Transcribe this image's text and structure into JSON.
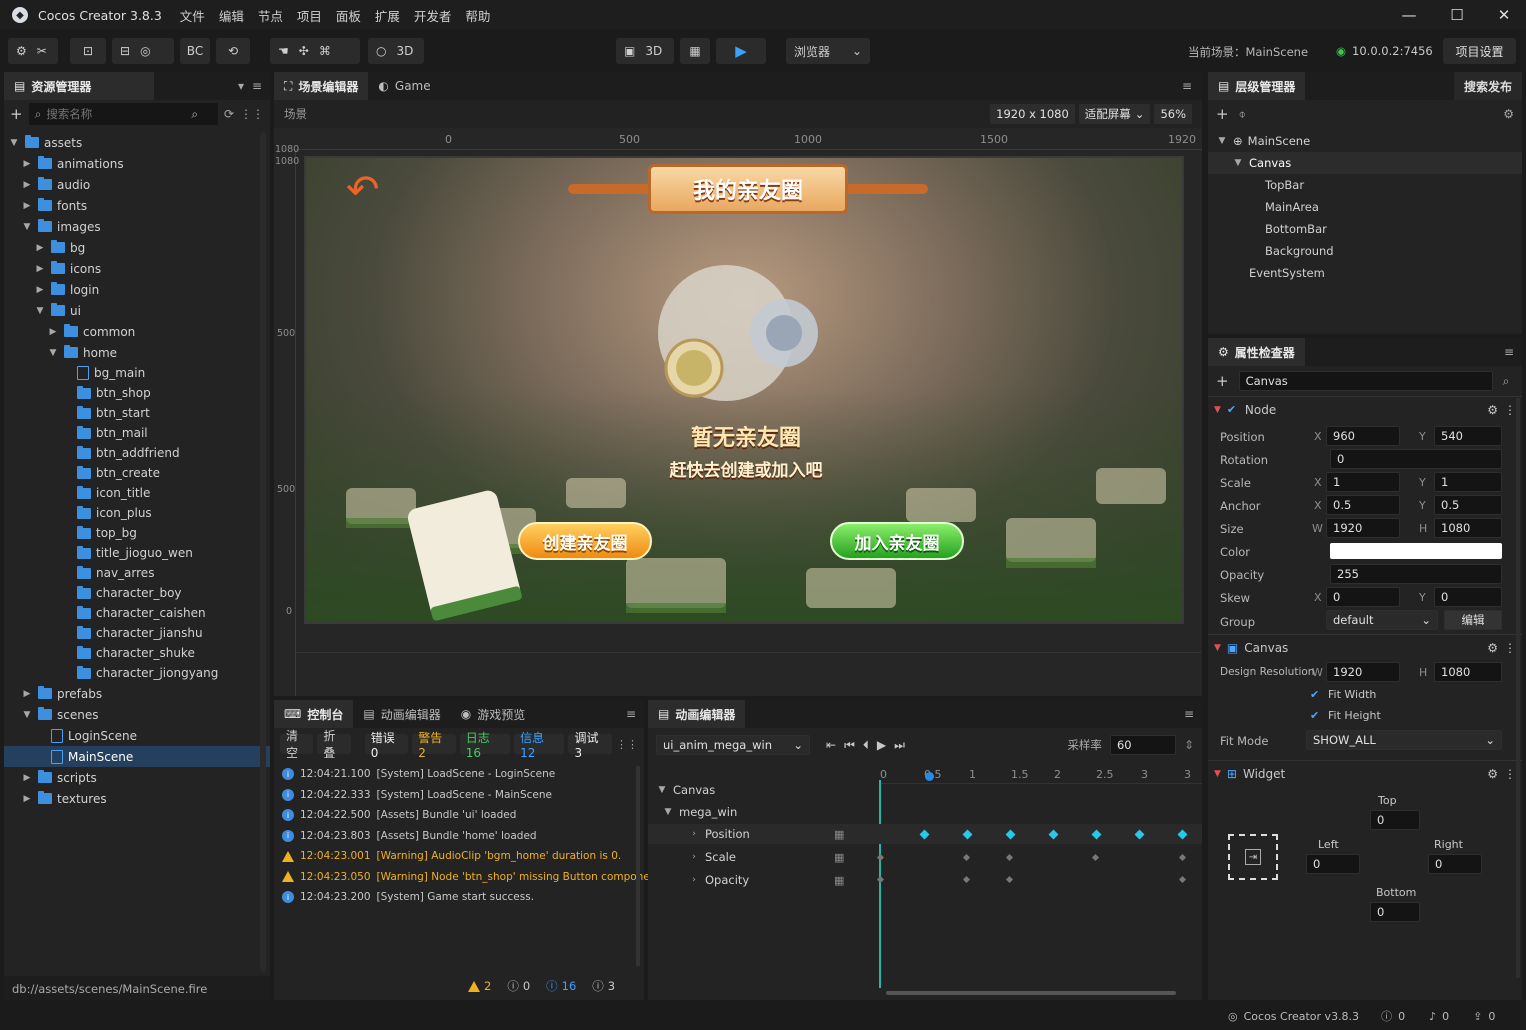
{
  "app": {
    "title": "Cocos Creator 3.8.3"
  },
  "menu": [
    "文件",
    "编辑",
    "节点",
    "项目",
    "面板",
    "扩展",
    "开发者",
    "帮助"
  ],
  "toolbar": {
    "bc": "BC",
    "mode3d": "3D",
    "view3d": "3D",
    "preview_target": "浏览器",
    "current_scene_label": "当前场景：",
    "current_scene": "MainScene",
    "ip": "10.0.0.2:7456",
    "project_settings": "项目设置"
  },
  "assets": {
    "tab": "资源管理器",
    "search_placeholder": "搜索名称",
    "tree": [
      {
        "label": "assets",
        "depth": 0,
        "type": "folder",
        "open": true
      },
      {
        "label": "animations",
        "depth": 1,
        "type": "folder"
      },
      {
        "label": "audio",
        "depth": 1,
        "type": "folder"
      },
      {
        "label": "fonts",
        "depth": 1,
        "type": "folder"
      },
      {
        "label": "images",
        "depth": 1,
        "type": "folder",
        "open": true
      },
      {
        "label": "bg",
        "depth": 2,
        "type": "folder"
      },
      {
        "label": "icons",
        "depth": 2,
        "type": "folder"
      },
      {
        "label": "login",
        "depth": 2,
        "type": "folder"
      },
      {
        "label": "ui",
        "depth": 2,
        "type": "folder",
        "open": true
      },
      {
        "label": "common",
        "depth": 3,
        "type": "folder"
      },
      {
        "label": "home",
        "depth": 3,
        "type": "folder",
        "open": true
      },
      {
        "label": "bg_main",
        "depth": 4,
        "type": "file"
      },
      {
        "label": "btn_shop",
        "depth": 4,
        "type": "leaf-folder"
      },
      {
        "label": "btn_start",
        "depth": 4,
        "type": "leaf-folder"
      },
      {
        "label": "btn_mail",
        "depth": 4,
        "type": "leaf-folder"
      },
      {
        "label": "btn_addfriend",
        "depth": 4,
        "type": "leaf-folder"
      },
      {
        "label": "btn_create",
        "depth": 4,
        "type": "leaf-folder"
      },
      {
        "label": "icon_title",
        "depth": 4,
        "type": "leaf-folder"
      },
      {
        "label": "icon_plus",
        "depth": 4,
        "type": "leaf-folder"
      },
      {
        "label": "top_bg",
        "depth": 4,
        "type": "leaf-folder"
      },
      {
        "label": "title_jioguo_wen",
        "depth": 4,
        "type": "leaf-folder"
      },
      {
        "label": "nav_arres",
        "depth": 4,
        "type": "leaf-folder"
      },
      {
        "label": "character_boy",
        "depth": 4,
        "type": "leaf-folder"
      },
      {
        "label": "character_caishen",
        "depth": 4,
        "type": "leaf-folder"
      },
      {
        "label": "character_jianshu",
        "depth": 4,
        "type": "leaf-folder"
      },
      {
        "label": "character_shuke",
        "depth": 4,
        "type": "leaf-folder"
      },
      {
        "label": "character_jiongyang",
        "depth": 4,
        "type": "leaf-folder"
      },
      {
        "label": "prefabs",
        "depth": 1,
        "type": "folder"
      },
      {
        "label": "scenes",
        "depth": 1,
        "type": "folder",
        "open": true
      },
      {
        "label": "LoginScene",
        "depth": 2,
        "type": "file"
      },
      {
        "label": "MainScene",
        "depth": 2,
        "type": "file",
        "selected": true
      },
      {
        "label": "scripts",
        "depth": 1,
        "type": "folder"
      },
      {
        "label": "textures",
        "depth": 1,
        "type": "folder"
      }
    ],
    "footer_path": "db://assets/scenes/MainScene.fire"
  },
  "scene": {
    "tabs": [
      "场景编辑器",
      "Game"
    ],
    "breadcrumb": "场景",
    "resolution": "1920 x 1080",
    "fit": "适配屏幕",
    "zoom": "56%",
    "ruler_top": [
      "0",
      "500",
      "1000",
      "1500",
      "1920"
    ],
    "ruler_left": [
      "1080",
      "1080",
      "500",
      "500",
      "0"
    ],
    "game": {
      "title": "我的亲友圈",
      "empty_title": "暂无亲友圈",
      "empty_sub": "赶快去创建或加入吧",
      "btn_create": "创建亲友圈",
      "btn_join": "加入亲友圈"
    }
  },
  "console": {
    "tabs": [
      "控制台",
      "动画编辑器",
      "游戏预览"
    ],
    "buttons": {
      "clear": "清空",
      "fold": "折叠"
    },
    "filters": {
      "error": "错误 0",
      "warn": "警告 2",
      "log": "日志 16",
      "info": "信息 12",
      "debug": "调试 3"
    },
    "logs": [
      {
        "level": "info",
        "time": "12:04:21.100",
        "text": "[System] LoadScene - LoginScene"
      },
      {
        "level": "info",
        "time": "12:04:22.333",
        "text": "[System] LoadScene - MainScene"
      },
      {
        "level": "info",
        "time": "12:04:22.500",
        "text": "[Assets] Bundle 'ui' loaded"
      },
      {
        "level": "info",
        "time": "12:04:23.803",
        "text": "[Assets] Bundle 'home' loaded"
      },
      {
        "level": "warn",
        "time": "12:04:23.001",
        "text": "[Warning] AudioClip 'bgm_home' duration is 0."
      },
      {
        "level": "warn",
        "time": "12:04:23.050",
        "text": "[Warning] Node 'btn_shop' missing Button component"
      },
      {
        "level": "info",
        "time": "12:04:23.200",
        "text": "[System] Game start success."
      }
    ],
    "footer": {
      "warn": "2",
      "error": "0",
      "info": "16",
      "debug": "3"
    }
  },
  "animation": {
    "tab": "动画编辑器",
    "clip": "ui_anim_mega_win",
    "sample_label": "采样率",
    "sample": "60",
    "ticks": [
      "0",
      "0.5",
      "1",
      "1.5",
      "2",
      "2.5",
      "3",
      "3"
    ],
    "tracks": [
      {
        "label": "Canvas",
        "depth": 0
      },
      {
        "label": "mega_win",
        "depth": 1
      },
      {
        "label": "Position",
        "depth": 2
      },
      {
        "label": "Scale",
        "depth": 2
      },
      {
        "label": "Opacity",
        "depth": 2
      }
    ]
  },
  "hierarchy": {
    "tab": "层级管理器",
    "search_tab": "搜索发布",
    "tree": [
      {
        "label": "MainScene",
        "depth": 0
      },
      {
        "label": "Canvas",
        "depth": 1,
        "selected": true
      },
      {
        "label": "TopBar",
        "depth": 2
      },
      {
        "label": "MainArea",
        "depth": 2
      },
      {
        "label": "BottomBar",
        "depth": 2
      },
      {
        "label": "Background",
        "depth": 2
      },
      {
        "label": "EventSystem",
        "depth": 1
      }
    ]
  },
  "inspector": {
    "tab": "属性检查器",
    "node_name": "Canvas",
    "node_section": "Node",
    "position": {
      "label": "Position",
      "x": "960",
      "y": "540"
    },
    "rotation": {
      "label": "Rotation",
      "v": "0"
    },
    "scale": {
      "label": "Scale",
      "x": "1",
      "y": "1"
    },
    "anchor": {
      "label": "Anchor",
      "x": "0.5",
      "y": "0.5"
    },
    "size": {
      "label": "Size",
      "w": "1920",
      "h": "1080"
    },
    "color": {
      "label": "Color",
      "value": "#ffffff"
    },
    "opacity": {
      "label": "Opacity",
      "v": "255"
    },
    "skew": {
      "label": "Skew",
      "x": "0",
      "y": "0"
    },
    "group": {
      "label": "Group",
      "v": "default",
      "edit": "编辑"
    },
    "canvas_section": "Canvas",
    "design_res": {
      "label": "Design Resolution",
      "w": "1920",
      "h": "1080"
    },
    "fit_width": "Fit Width",
    "fit_height": "Fit Height",
    "fit_mode": {
      "label": "Fit Mode",
      "v": "SHOW_ALL"
    },
    "widget_section": "Widget",
    "widget": {
      "top_label": "Top",
      "top": "0",
      "left_label": "Left",
      "left": "0",
      "right_label": "Right",
      "right": "0",
      "bottom_label": "Bottom",
      "bottom": "0"
    }
  },
  "statusbar": {
    "version": "Cocos Creator v3.8.3",
    "a": "0",
    "b": "0",
    "c": "0"
  },
  "axis_labels": {
    "x": "X",
    "y": "Y",
    "w": "W",
    "h": "H"
  }
}
